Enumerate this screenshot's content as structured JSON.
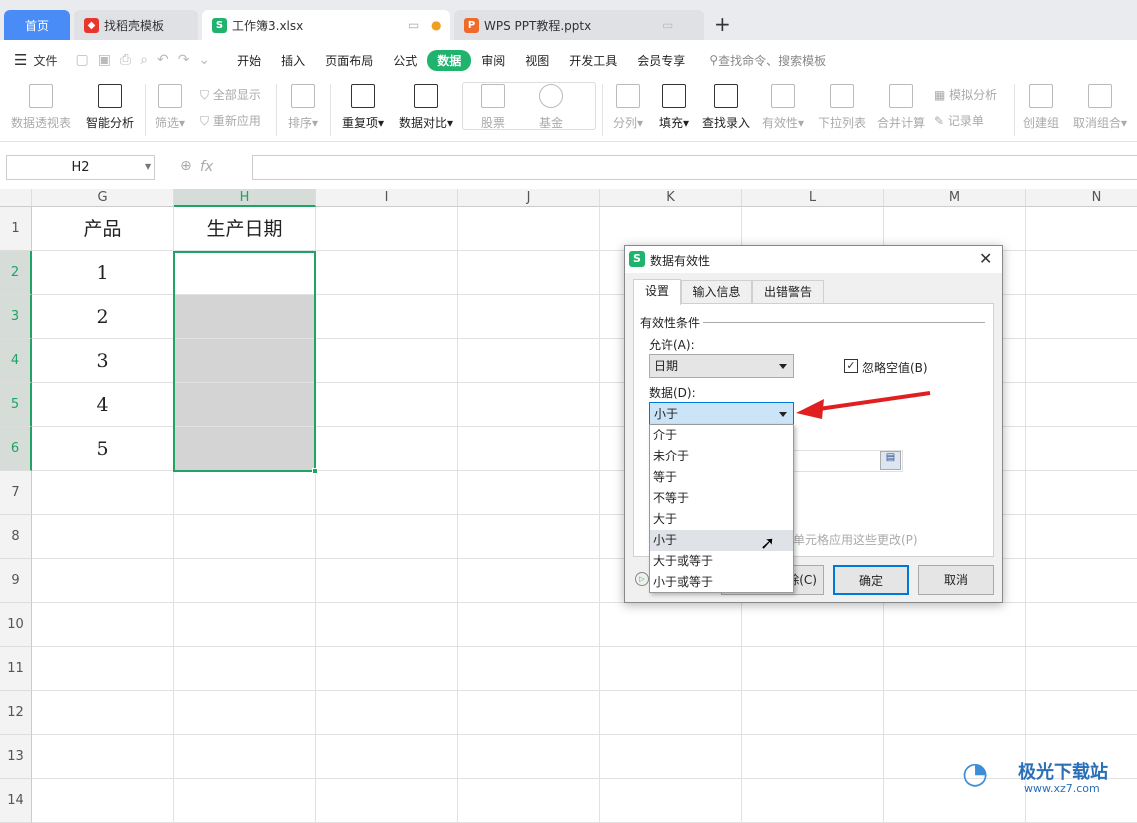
{
  "tabs": [
    {
      "label": "首页",
      "active": false
    },
    {
      "label": "找稻壳模板"
    },
    {
      "label": "工作簿3.xlsx",
      "active": true
    },
    {
      "label": "WPS PPT教程.pptx"
    }
  ],
  "new_tab": "+",
  "menu": {
    "file": "文件",
    "items": [
      "开始",
      "插入",
      "页面布局",
      "公式",
      "数据",
      "审阅",
      "视图",
      "开发工具",
      "会员专享"
    ],
    "active": "数据",
    "search": "查找命令、搜索模板"
  },
  "ribbon": {
    "pivot": "数据透视表",
    "smart": "智能分析",
    "filter": "筛选",
    "show_all": "全部显示",
    "reapply": "重新应用",
    "sort": "排序",
    "dup": "重复项",
    "compare": "数据对比",
    "stock": "股票",
    "fund": "基金",
    "split": "分列",
    "fill": "填充",
    "lookup": "查找录入",
    "validity": "有效性",
    "dropdown": "下拉列表",
    "consolidate": "合并计算",
    "whatif": "模拟分析",
    "record": "记录单",
    "group": "创建组",
    "ungroup": "取消组合"
  },
  "formula_bar": {
    "cell_ref": "H2",
    "fx": "fx",
    "value": ""
  },
  "sheet": {
    "columns": [
      "G",
      "H",
      "I",
      "J",
      "K",
      "L",
      "M",
      "N"
    ],
    "rows": [
      "1",
      "2",
      "3",
      "4",
      "5",
      "6",
      "7",
      "8",
      "9",
      "10",
      "11",
      "12",
      "13",
      "14"
    ],
    "G": [
      "产品",
      "1",
      "2",
      "3",
      "4",
      "5"
    ],
    "H": [
      "生产日期"
    ]
  },
  "dialog": {
    "title": "数据有效性",
    "tabs": [
      "设置",
      "输入信息",
      "出错警告"
    ],
    "group": "有效性条件",
    "allow_label": "允许(A):",
    "allow_value": "日期",
    "ignore_blank": "忽略空值(B)",
    "ignore_blank_checked": true,
    "data_label": "数据(D):",
    "data_value": "小于",
    "apply_all": "所有单元格应用这些更改(P)",
    "clear": "全部清除(C)",
    "ok": "确定",
    "cancel": "取消",
    "options": [
      "介于",
      "未介于",
      "等于",
      "不等于",
      "大于",
      "小于",
      "大于或等于",
      "小于或等于"
    ],
    "hovered": "小于"
  },
  "watermark": {
    "name": "极光下载站",
    "url": "www.xz7.com"
  },
  "colors": {
    "accent": "#1fb36e",
    "selection": "#1fa463",
    "arrow": "#e02020"
  }
}
